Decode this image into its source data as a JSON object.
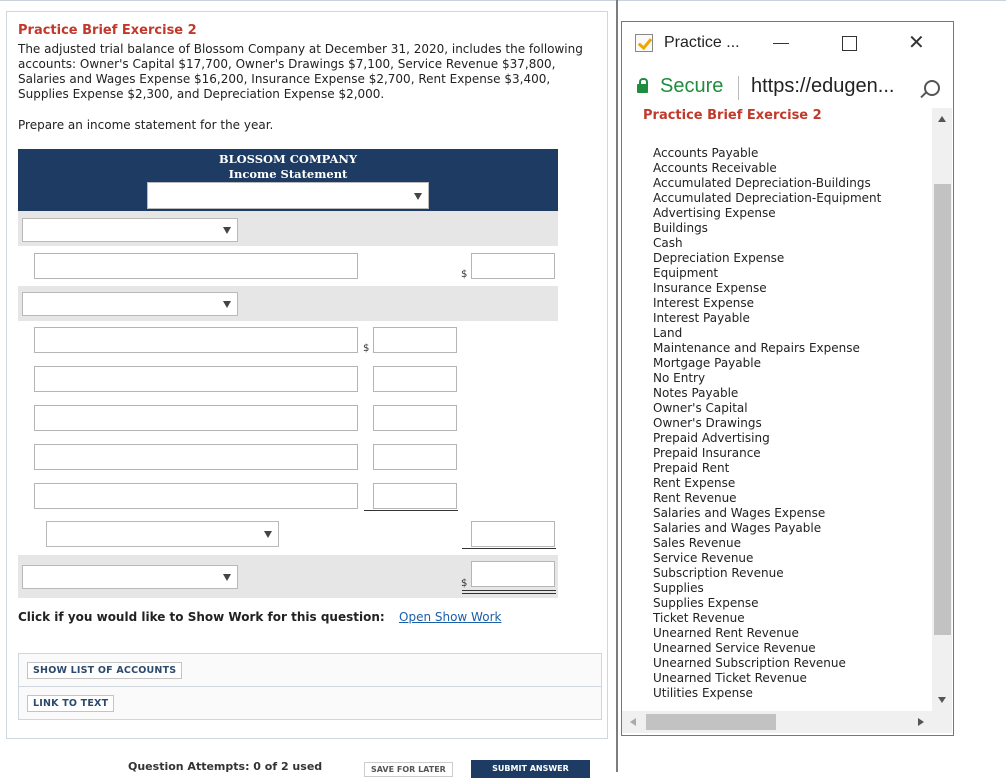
{
  "exercise": {
    "title": "Practice Brief Exercise 2",
    "description": "The adjusted trial balance of Blossom Company at December 31, 2020, includes the following accounts: Owner's Capital $17,700, Owner's Drawings $7,100, Service Revenue $37,800, Salaries and Wages Expense $16,200, Insurance Expense $2,700, Rent Expense $3,400, Supplies Expense $2,300, and Depreciation Expense $2,000.",
    "prompt": "Prepare an income statement for the year."
  },
  "statement": {
    "company": "BLOSSOM COMPANY",
    "subtitle": "Income Statement",
    "currency_symbol": "$"
  },
  "show_work": {
    "label": "Click if you would like to Show Work for this question:",
    "link": "Open Show Work"
  },
  "buttons": {
    "show_list": "SHOW LIST OF ACCOUNTS",
    "link_to_text": "LINK TO TEXT",
    "save_later": "SAVE FOR LATER",
    "submit": "SUBMIT ANSWER"
  },
  "attempts": "Question Attempts: 0 of 2 used",
  "popup": {
    "window_title": "Practice ...",
    "secure_label": "Secure",
    "url": "https://edugen...",
    "heading": "Practice Brief Exercise 2",
    "accounts": [
      "Accounts Payable",
      "Accounts Receivable",
      "Accumulated Depreciation-Buildings",
      "Accumulated Depreciation-Equipment",
      "Advertising Expense",
      "Buildings",
      "Cash",
      "Depreciation Expense",
      "Equipment",
      "Insurance Expense",
      "Interest Expense",
      "Interest Payable",
      "Land",
      "Maintenance and Repairs Expense",
      "Mortgage Payable",
      "No Entry",
      "Notes Payable",
      "Owner's Capital",
      "Owner's Drawings",
      "Prepaid Advertising",
      "Prepaid Insurance",
      "Prepaid Rent",
      "Rent Expense",
      "Rent Revenue",
      "Salaries and Wages Expense",
      "Salaries and Wages Payable",
      "Sales Revenue",
      "Service Revenue",
      "Subscription Revenue",
      "Supplies",
      "Supplies Expense",
      "Ticket Revenue",
      "Unearned Rent Revenue",
      "Unearned Service Revenue",
      "Unearned Subscription Revenue",
      "Unearned Ticket Revenue",
      "Utilities Expense"
    ]
  },
  "colors": {
    "accent_red": "#c0392b",
    "header_navy": "#1e3c63",
    "secure_green": "#1e8e3e",
    "link_blue": "#1a5fa8"
  }
}
